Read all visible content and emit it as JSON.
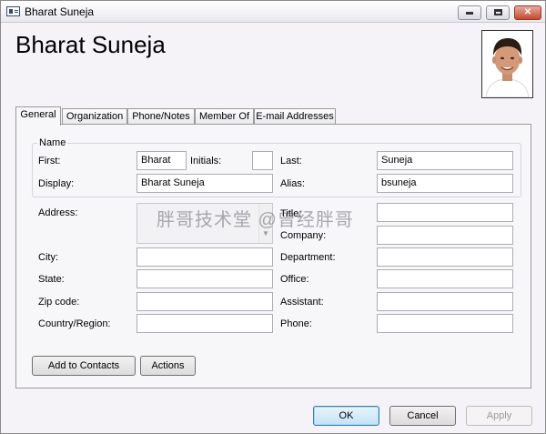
{
  "window": {
    "title": "Bharat Suneja"
  },
  "header": {
    "contact_name": "Bharat Suneja"
  },
  "tabs": [
    {
      "label": "General",
      "active": true
    },
    {
      "label": "Organization"
    },
    {
      "label": "Phone/Notes"
    },
    {
      "label": "Member Of"
    },
    {
      "label": "E-mail Addresses"
    }
  ],
  "name_group": {
    "label": "Name",
    "first_label": "First:",
    "first_value": "Bharat",
    "initials_label": "Initials:",
    "initials_value": "",
    "last_label": "Last:",
    "last_value": "Suneja",
    "display_label": "Display:",
    "display_value": "Bharat Suneja",
    "alias_label": "Alias:",
    "alias_value": "bsuneja"
  },
  "address_fields": {
    "address_label": "Address:",
    "address_value": "",
    "city_label": "City:",
    "city_value": "",
    "state_label": "State:",
    "state_value": "",
    "zip_label": "Zip code:",
    "zip_value": "",
    "country_label": "Country/Region:",
    "country_value": ""
  },
  "org_fields": {
    "title_label": "Title:",
    "title_value": "",
    "company_label": "Company:",
    "company_value": "",
    "department_label": "Department:",
    "department_value": "",
    "office_label": "Office:",
    "office_value": "",
    "assistant_label": "Assistant:",
    "assistant_value": "",
    "phone_label": "Phone:",
    "phone_value": ""
  },
  "actions": {
    "add_to_contacts": "Add to Contacts",
    "actions": "Actions"
  },
  "footer": {
    "ok": "OK",
    "cancel": "Cancel",
    "apply": "Apply"
  },
  "watermark": "胖哥技术堂 @曾经胖哥",
  "icons": {
    "window": "contact-card-icon",
    "minimize": "minimize-icon",
    "maximize": "maximize-icon",
    "close": "close-icon"
  },
  "colors": {
    "close_button": "#c44b32",
    "default_button": "#3c7fb1",
    "window_bg": "#f5f3f7"
  }
}
